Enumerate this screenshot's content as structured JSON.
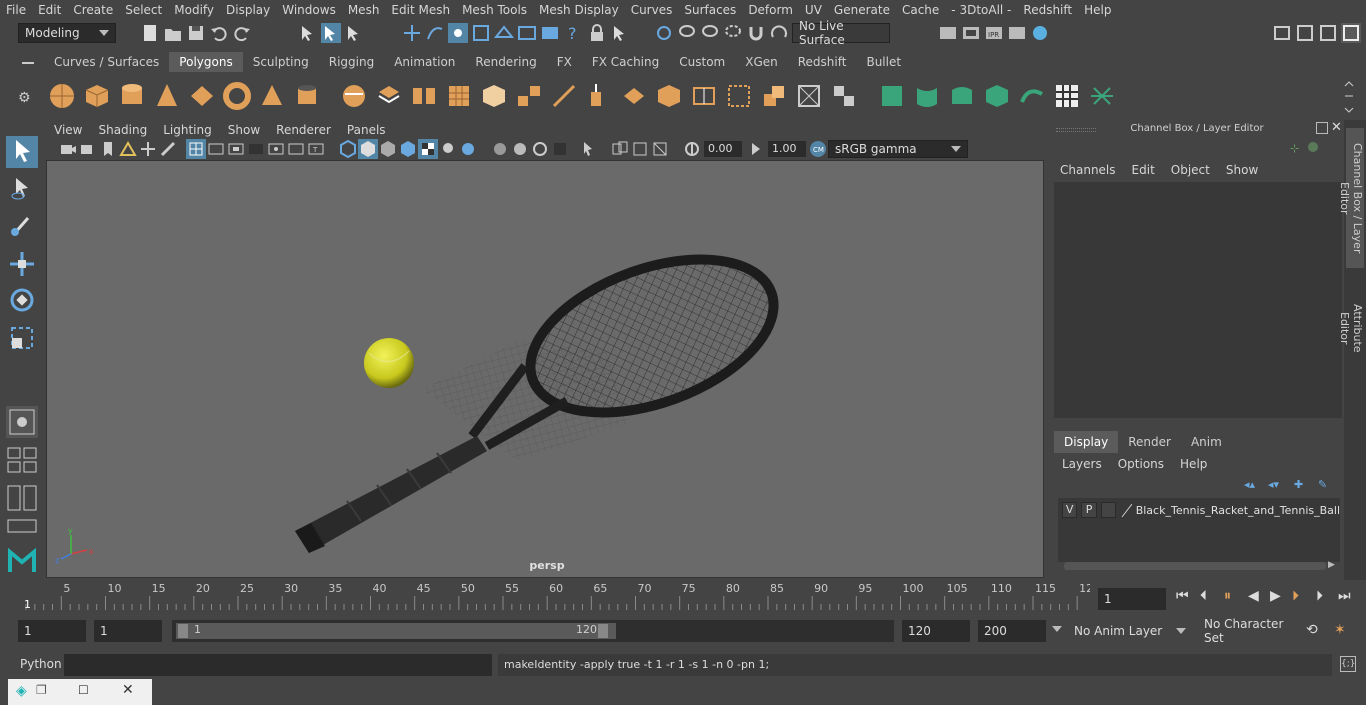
{
  "menubar": {
    "items": [
      "File",
      "Edit",
      "Create",
      "Select",
      "Modify",
      "Display",
      "Windows",
      "Mesh",
      "Edit Mesh",
      "Mesh Tools",
      "Mesh Display",
      "Curves",
      "Surfaces",
      "Deform",
      "UV",
      "Generate",
      "Cache",
      "- 3DtoAll -",
      "Redshift",
      "Help"
    ]
  },
  "statusline": {
    "mode": "Modeling",
    "live_surface": "No Live Surface"
  },
  "shelf": {
    "tabs": [
      "Curves / Surfaces",
      "Polygons",
      "Sculpting",
      "Rigging",
      "Animation",
      "Rendering",
      "FX",
      "FX Caching",
      "Custom",
      "XGen",
      "Redshift",
      "Bullet"
    ],
    "active_tab": "Polygons"
  },
  "viewport": {
    "menus": [
      "View",
      "Shading",
      "Lighting",
      "Show",
      "Renderer",
      "Panels"
    ],
    "exposure": "0.00",
    "gamma": "1.00",
    "color_space": "sRGB gamma",
    "camera_label": "persp"
  },
  "channelbox": {
    "title": "Channel Box / Layer Editor",
    "menus": [
      "Channels",
      "Edit",
      "Object",
      "Show"
    ],
    "layer_tabs": [
      "Display",
      "Render",
      "Anim"
    ],
    "active_layer_tab": "Display",
    "layer_menus": [
      "Layers",
      "Options",
      "Help"
    ],
    "layer": {
      "visible": "V",
      "playback": "P",
      "name": "Black_Tennis_Racket_and_Tennis_Ball"
    },
    "side_tabs": [
      "Channel Box / Layer Editor",
      "Attribute Editor"
    ]
  },
  "timeline": {
    "ticks": [
      "5",
      "10",
      "15",
      "20",
      "25",
      "30",
      "35",
      "40",
      "45",
      "50",
      "55",
      "60",
      "65",
      "70",
      "75",
      "80",
      "85",
      "90",
      "95",
      "100",
      "105",
      "110",
      "115",
      "12"
    ],
    "current_frame_marker": "1",
    "current_frame": "1"
  },
  "range": {
    "start": "1",
    "playback_start": "1",
    "slider_start": "1",
    "slider_end": "120",
    "playback_end": "120",
    "end": "200",
    "anim_layer": "No Anim Layer",
    "character_set": "No Character Set"
  },
  "cmdline": {
    "language": "Python",
    "last_command": "makeIdentity -apply true -t 1 -r 1 -s 1 -n 0 -pn 1;"
  },
  "colors": {
    "background": "#444444",
    "viewport_bg": "#6a6a6a",
    "accent_blue": "#5285a6",
    "shelf_orange": "#e0a05a",
    "shelf_green": "#3aa57a",
    "ball_yellow": "#d6d823"
  }
}
